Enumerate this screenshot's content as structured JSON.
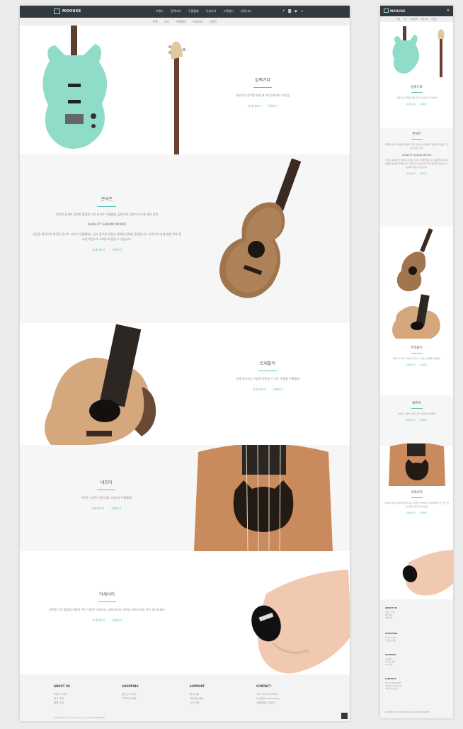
{
  "header": {
    "logo": "MOOUKE",
    "nav": [
      "브랜드",
      "일렉기타",
      "우쿨렐레",
      "악세서리",
      "고객센터",
      "커뮤니티"
    ]
  },
  "subnav": [
    "전체",
    "기타",
    "우쿨렐레",
    "악세사리",
    "이벤트"
  ],
  "sections": [
    {
      "title": "일렉기타",
      "desc": "자유로운 연주를 위한 최고의 일렉기타 라인업",
      "links": [
        "자세히보기",
        "구매하기"
      ]
    },
    {
      "title": "콘서트",
      "desc": "따뜻한 음색과 풍부한 울림을 가진 콘서트 우쿨렐레, 입문자와 전문가 모두를 위한 선택",
      "sub_title": "QUALITY SOUND WOOD",
      "desc2": "엄선된 원목으로 제작된 콘서트 사이즈 우쿨렐레는 깊고 풍부한 공명과 선명한 음색을 들려줍니다. 연주자의 손에 맞춘 넥과 정교한 마감으로 오래도록 즐길 수 있습니다.",
      "links": [
        "자세히보기",
        "구매하기"
      ]
    },
    {
      "title": "트래블러",
      "desc": "언제 어디서나 가볍게 연주할 수 있는 여행용 우쿨렐레",
      "links": [
        "자세히보기",
        "구매하기"
      ]
    },
    {
      "title": "네즈미",
      "desc": "귀여운 고양이 사운드홀 디자인의 우쿨렐레",
      "links": [
        "자세히보기",
        "구매하기"
      ]
    },
    {
      "title": "악세서리",
      "desc": "연주를 더욱 즐겁게 만들어 주는 다양한 악세서리, 쉐이커부터 스트랩, 케이스까지 모두 만나보세요",
      "links": [
        "자세히보기",
        "구매하기"
      ]
    }
  ],
  "footer": {
    "columns": [
      {
        "head": "ABOUT US",
        "lines": [
          "브랜드 소개",
          "회사 위치",
          "채용 안내"
        ]
      },
      {
        "head": "SHOPPING",
        "lines": [
          "온라인 스토어",
          "오프라인 매장"
        ]
      },
      {
        "head": "SUPPORT",
        "lines": [
          "공지사항",
          "자주묻는질문",
          "A/S 안내"
        ]
      },
      {
        "head": "CONTACT",
        "lines": [
          "TEL 02-000-0000",
          "info@moouke.com",
          "서울특별시 강남구"
        ]
      }
    ],
    "copyright": "COPYRIGHT © MOOUKE. ALL RIGHTS RESERVED."
  },
  "colors": {
    "accent": "#5ec3b8",
    "topbar": "#333a3f"
  },
  "icons": [
    "facebook-icon",
    "instagram-icon",
    "youtube-icon",
    "search-icon",
    "menu-icon",
    "arrow-up-icon"
  ]
}
